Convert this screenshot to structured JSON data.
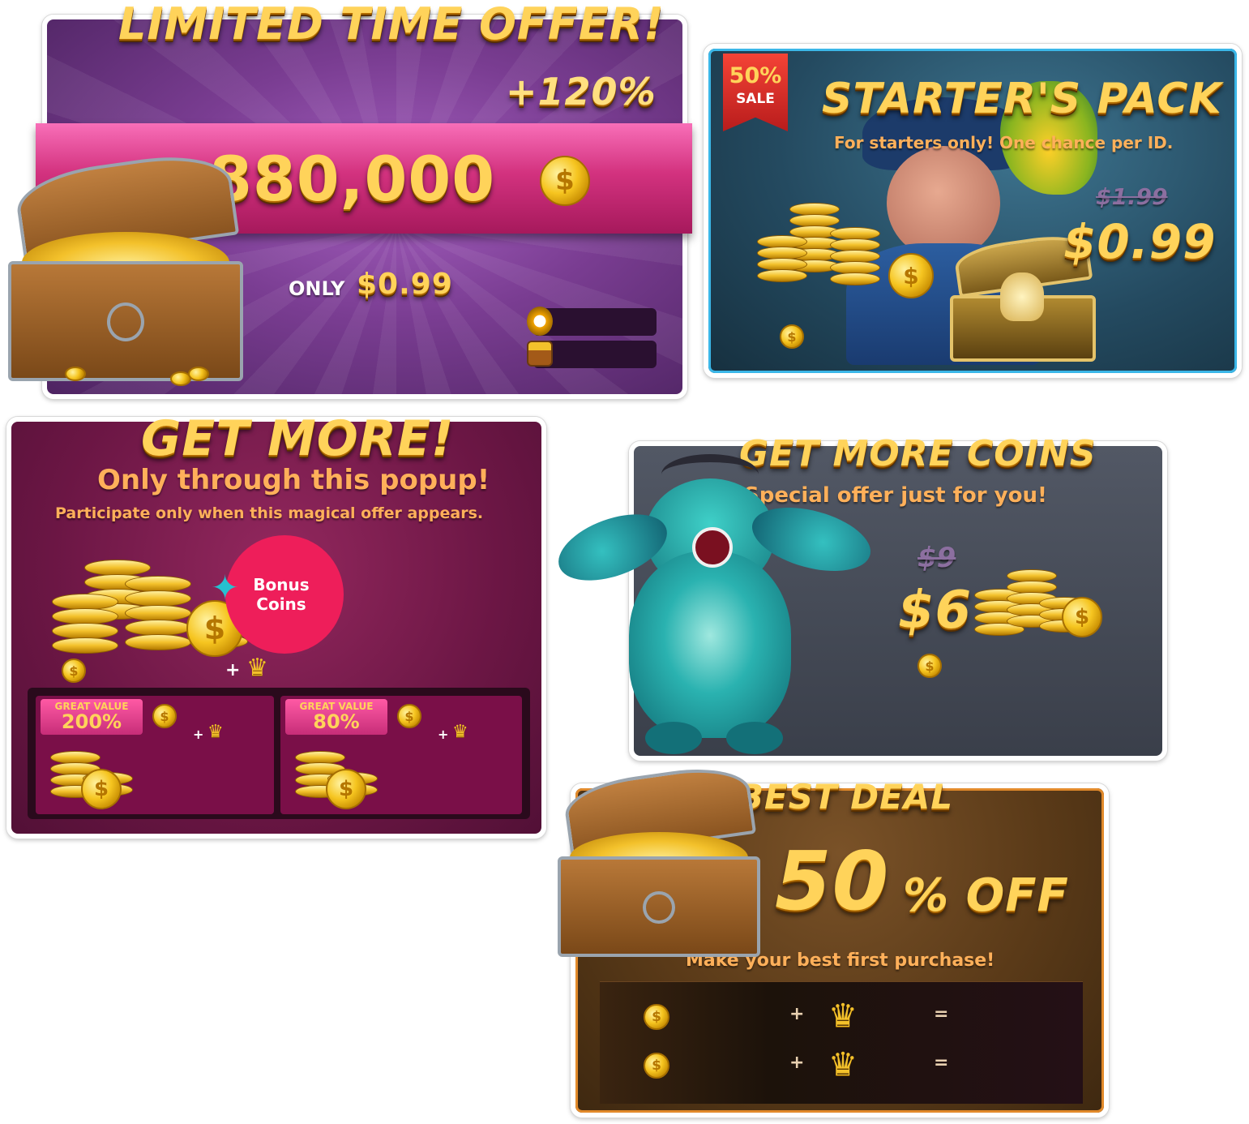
{
  "limited_offer": {
    "title": "LIMITED TIME OFFER!",
    "bonus": "+120%",
    "amount": "880,000",
    "only_label": "ONLY",
    "price": "$0.99",
    "coin_symbol": "$"
  },
  "starters_pack": {
    "badge_top": "50%",
    "badge_bottom": "SALE",
    "title": "STARTER'S PACK",
    "subtitle": "For starters only! One chance per ID.",
    "old_price": "$1.99",
    "price": "$0.99",
    "coin_symbol": "$"
  },
  "get_more": {
    "title": "GET MORE!",
    "subtitle": "Only through this popup!",
    "description": "Participate only when this magical offer appears.",
    "bonus_label": "Bonus\nCoins",
    "plus": "+",
    "coin_symbol": "$",
    "options": [
      {
        "badge_top": "GREAT VALUE",
        "badge_value": "200%",
        "plus": "+"
      },
      {
        "badge_top": "GREAT VALUE",
        "badge_value": "80%",
        "plus": "+"
      }
    ]
  },
  "get_more_coins": {
    "title": "GET MORE COINS",
    "subtitle": "Special offer just for you!",
    "old_price": "$9",
    "price": "$6",
    "coin_symbol": "$"
  },
  "best_deal": {
    "title": "BEST DEAL",
    "discount_number": "50",
    "discount_suffix": "% OFF",
    "subtitle": "Make your best first purchase!",
    "rows": [
      {
        "coin_symbol": "$",
        "plus": "+",
        "equals": "="
      },
      {
        "coin_symbol": "$",
        "plus": "+",
        "equals": "="
      }
    ]
  },
  "icons": {
    "crown": "crown-icon",
    "coin": "coin-icon",
    "stopwatch": "stopwatch-icon",
    "chest": "treasure-chest-icon"
  }
}
